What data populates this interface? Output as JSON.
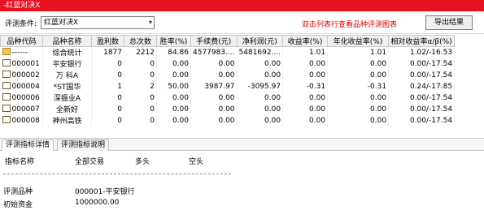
{
  "window": {
    "title": "-红蓝对决X"
  },
  "toolbar": {
    "condition_label": "评测条件:",
    "condition_value": "红蓝对决X",
    "hint": "双击列表行查看品种评测图表",
    "export_label": "导出结果"
  },
  "table": {
    "headers": [
      "品种代码",
      "品种名称",
      "盈利数",
      "总次数",
      "胜率(%)",
      "手续费(元)",
      "净利润(元)",
      "收益率(%)",
      "年化收益率(%)",
      "相对收益率α/β(%)"
    ],
    "rows": [
      {
        "icon": "folder-icon",
        "code": "------",
        "name": "综合统计",
        "wins": "1877",
        "total": "2212",
        "win_rate": "84.86",
        "fee": "4577983....",
        "net_profit": "5481692....",
        "return": "1.01",
        "annual_return": "1.01",
        "relative": "1.02/-16.53"
      },
      {
        "icon": "document-icon",
        "code": "000001",
        "name": "平安银行",
        "wins": "0",
        "total": "0",
        "win_rate": "0.00",
        "fee": "0.00",
        "net_profit": "0.00",
        "return": "0.00",
        "annual_return": "0.00",
        "relative": "0.00/-17.54"
      },
      {
        "icon": "document-icon",
        "code": "000002",
        "name": "万 科A",
        "wins": "0",
        "total": "0",
        "win_rate": "0.00",
        "fee": "0.00",
        "net_profit": "0.00",
        "return": "0.00",
        "annual_return": "0.00",
        "relative": "0.00/-17.54"
      },
      {
        "icon": "document-icon",
        "code": "000004",
        "name": "*ST国华",
        "wins": "1",
        "total": "2",
        "win_rate": "50.00",
        "fee": "3987.97",
        "net_profit": "-3095.97",
        "return": "-0.31",
        "annual_return": "-0.31",
        "relative": "0.24/-17.85"
      },
      {
        "icon": "document-icon",
        "code": "000006",
        "name": "深振业A",
        "wins": "0",
        "total": "0",
        "win_rate": "0.00",
        "fee": "0.00",
        "net_profit": "0.00",
        "return": "0.00",
        "annual_return": "0.00",
        "relative": "0.00/-17.54"
      },
      {
        "icon": "document-icon",
        "code": "000007",
        "name": "全新好",
        "wins": "0",
        "total": "0",
        "win_rate": "0.00",
        "fee": "0.00",
        "net_profit": "0.00",
        "return": "0.00",
        "annual_return": "0.00",
        "relative": "0.00/-17.54"
      },
      {
        "icon": "document-icon",
        "code": "000008",
        "name": "神州高铁",
        "wins": "0",
        "total": "0",
        "win_rate": "0.00",
        "fee": "0.00",
        "net_profit": "0.00",
        "return": "0.00",
        "annual_return": "0.00",
        "relative": "0.00/-17.54"
      }
    ]
  },
  "tabs": [
    {
      "label": "评测指标详情",
      "active": true
    },
    {
      "label": "评测指标说明",
      "active": false
    }
  ],
  "detail": {
    "col_indicator": "指标名称",
    "col_all": "全部交易",
    "col_long": "多头",
    "col_short": "空头",
    "product_label": "评测品种",
    "product_value": "000001-平安银行",
    "capital_label": "初始资金",
    "capital_value": "1000000.00"
  },
  "colors": {
    "titlebar": "#e81123",
    "hint": "#e00000"
  }
}
